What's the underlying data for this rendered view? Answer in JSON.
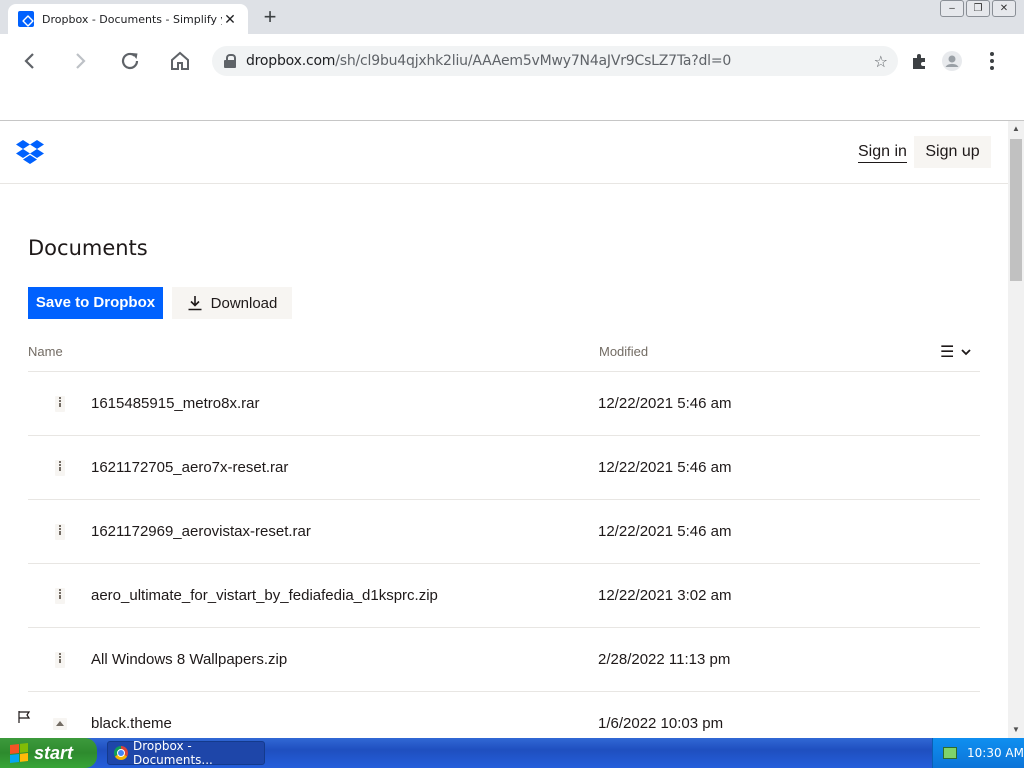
{
  "browser": {
    "tab_title": "Dropbox - Documents - Simplify your",
    "tab_close": "✕",
    "new_tab": "+",
    "url_host": "dropbox.com",
    "url_path": "/sh/cl9bu4qjxhk2liu/AAAem5vMwy7N4aJVr9CsLZ7Ta?dl=0",
    "window_controls": [
      "–",
      "❐",
      "✕"
    ]
  },
  "header": {
    "sign_in": "Sign in",
    "sign_up": "Sign up"
  },
  "page": {
    "title": "Documents",
    "save_button": "Save to Dropbox",
    "download_button": "Download",
    "col_name": "Name",
    "col_modified": "Modified",
    "view_icon": "☰"
  },
  "files": [
    {
      "name": "1615485915_metro8x.rar",
      "modified": "12/22/2021 5:46 am",
      "icon": "archive-icon"
    },
    {
      "name": "1621172705_aero7x-reset.rar",
      "modified": "12/22/2021 5:46 am",
      "icon": "archive-icon"
    },
    {
      "name": "1621172969_aerovistax-reset.rar",
      "modified": "12/22/2021 5:46 am",
      "icon": "archive-icon"
    },
    {
      "name": "aero_ultimate_for_vistart_by_fediafedia_d1ksprc.zip",
      "modified": "12/22/2021 3:02 am",
      "icon": "archive-icon"
    },
    {
      "name": "All Windows 8 Wallpapers.zip",
      "modified": "2/28/2022 11:13 pm",
      "icon": "archive-icon"
    },
    {
      "name": "black.theme",
      "modified": "1/6/2022 10:03 pm",
      "icon": "theme-file-icon"
    }
  ],
  "taskbar": {
    "start": "start",
    "task": "Dropbox - Documents...",
    "clock": "10:30 AM"
  },
  "colors": {
    "accent": "#0061fe",
    "secondary_button": "#f7f5f2"
  }
}
